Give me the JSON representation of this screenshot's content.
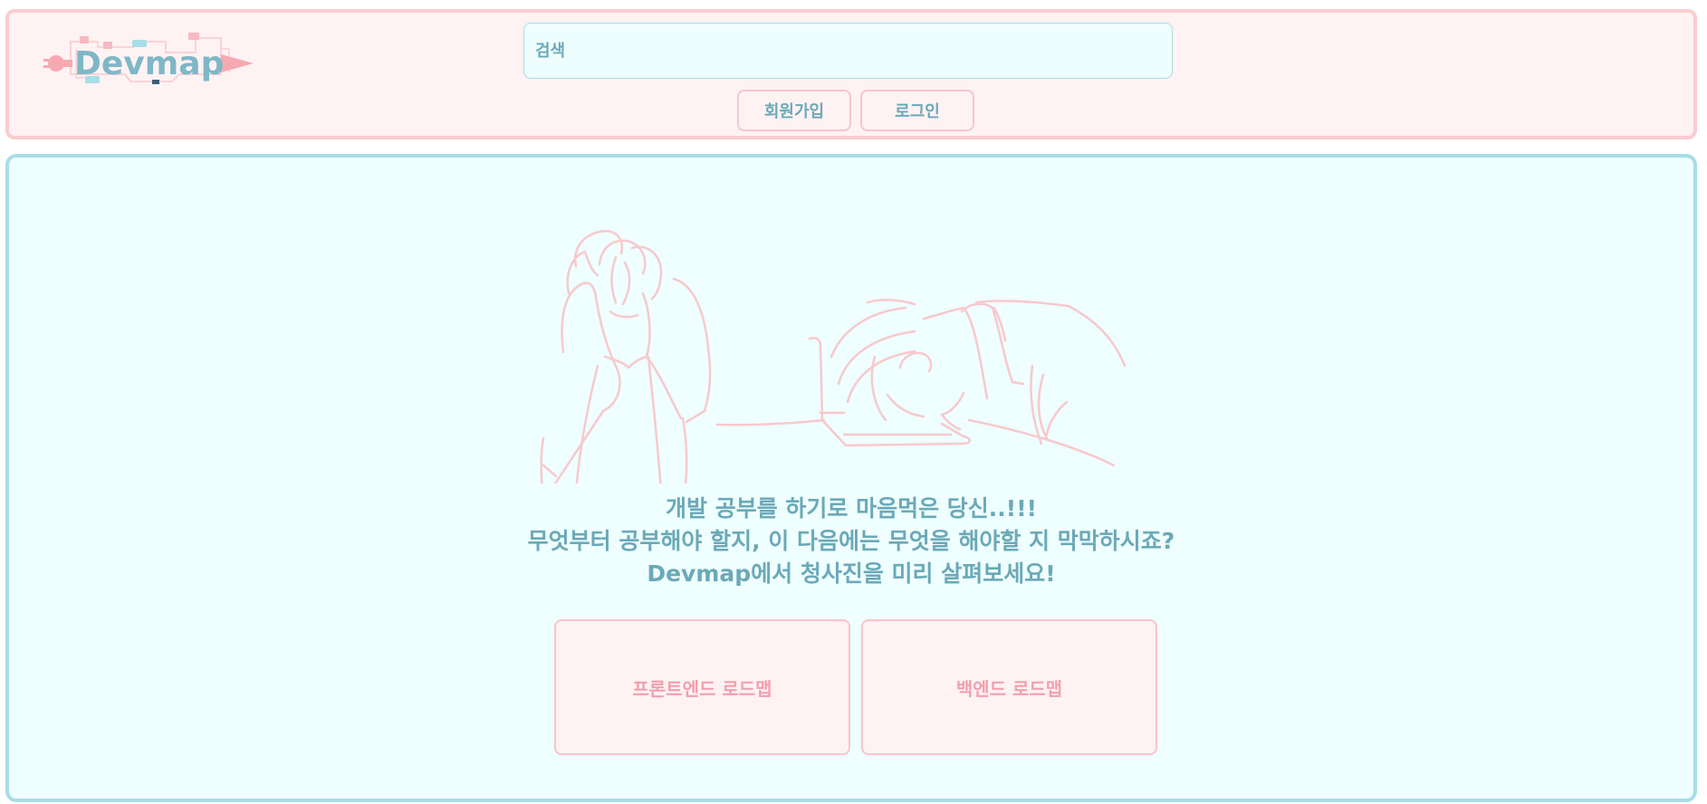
{
  "header": {
    "logo_text": "Devmap",
    "search": {
      "placeholder": "검색",
      "value": ""
    },
    "signup_label": "회원가입",
    "login_label": "로그인"
  },
  "main": {
    "intro_lines": [
      "개발 공부를 하기로 마음먹은 당신..!!!",
      "무엇부터 공부해야 할지, 이 다음에는 무엇을 해야할 지 막막하시죠?",
      "Devmap에서 청사진을 미리 살펴보세요!"
    ],
    "roadmaps": [
      {
        "label": "프론트엔드 로드맵"
      },
      {
        "label": "백엔드 로드맵"
      }
    ]
  },
  "icons": {
    "logo": "devmap-circuit-logo-icon",
    "illustration": "stressed-developers-illustration"
  },
  "colors": {
    "header_bg": "#fef2f3",
    "header_border": "#f9cdd0",
    "main_bg": "#effefe",
    "main_border": "#a9dde7",
    "text_teal": "#6ba9b8",
    "text_pink": "#f2a0ad",
    "line_pink": "#f7c9cd"
  }
}
